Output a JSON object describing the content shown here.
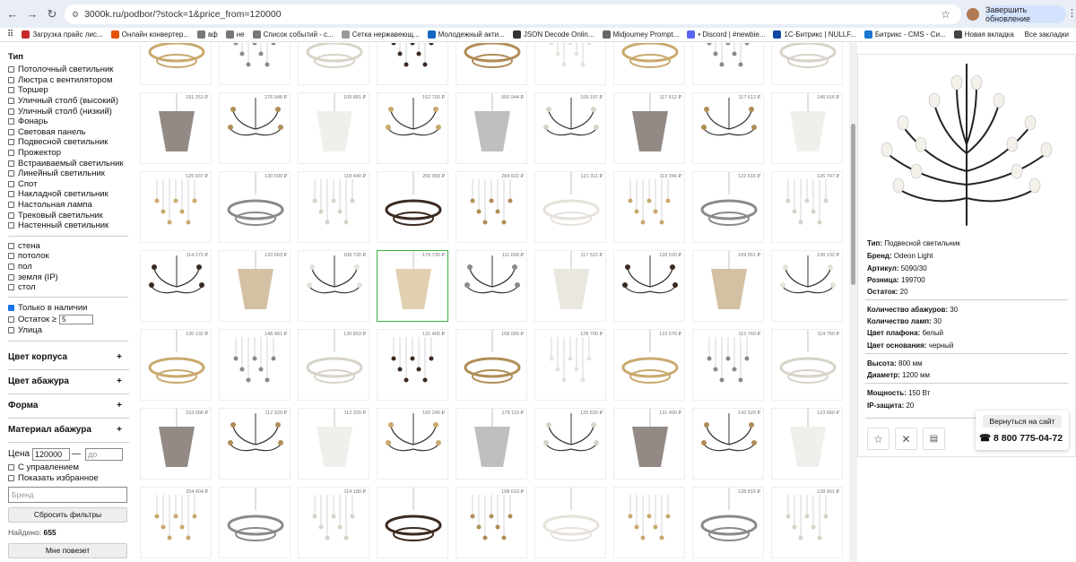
{
  "browser": {
    "url": "3000k.ru/podbor/?stock=1&price_from=120000",
    "update_label": "Завершить обновление",
    "bookmarks": [
      {
        "label": "Загрузка прайс лис...",
        "color": "#c62828"
      },
      {
        "label": "Онлайн конвертер...",
        "color": "#e65100"
      },
      {
        "label": "вф",
        "color": "#777"
      },
      {
        "label": "не",
        "color": "#777"
      },
      {
        "label": "Список событий - с...",
        "color": "#777"
      },
      {
        "label": "Сетка нержавеющ...",
        "color": "#999"
      },
      {
        "label": "Молодежный акти...",
        "color": "#1565c0"
      },
      {
        "label": "JSON Decode Onlin...",
        "color": "#333"
      },
      {
        "label": "Midjourney Prompt...",
        "color": "#666"
      },
      {
        "label": "• Discord | #newbie...",
        "color": "#5865f2"
      },
      {
        "label": "1С-Битрикс | NULLF...",
        "color": "#0d47a1"
      },
      {
        "label": "Битрикс - CMS - Си...",
        "color": "#1976d2"
      },
      {
        "label": "Новая вкладка",
        "color": "#444"
      }
    ],
    "all_bookmarks": "Все закладки"
  },
  "sidebar": {
    "type_heading": "Тип",
    "types": [
      "Потолочный светильник",
      "Люстра с вентилятором",
      "Торшер",
      "Уличный столб (высокий)",
      "Уличный столб (низкий)",
      "Фонарь",
      "Световая панель",
      "Подвесной светильник",
      "Прожектор",
      "Встраиваемый светильник",
      "Линейный светильник",
      "Спот",
      "Накладной светильник",
      "Настольная лампа",
      "Трековый светильник",
      "Настенный светильник"
    ],
    "mounts": [
      "стена",
      "потолок",
      "пол",
      "земля (IP)",
      "стол"
    ],
    "in_stock_label": "Только в наличии",
    "stock_label": "Остаток ≥",
    "stock_value": "5",
    "street_label": "Улица",
    "accordions": [
      "Цвет корпуса",
      "Цвет абажура",
      "Форма",
      "Материал абажура"
    ],
    "price_label": "Цена",
    "price_from": "120000",
    "price_to_placeholder": "до",
    "dimmer_label": "С управлением",
    "favorites_label": "Показать избранное",
    "brand_placeholder": "Бренд",
    "reset_label": "Сбросить фильтры",
    "found_label": "Найдено:",
    "found_count": "655",
    "lucky_label": "Мне повезет"
  },
  "grid": {
    "rows": [
      [
        "",
        "",
        "",
        "",
        "",
        "",
        "",
        "",
        ""
      ],
      [
        "181 253 ₽",
        "276 948 ₽",
        "109 881 ₽",
        "152 793 ₽",
        "560 944 ₽",
        "109 197 ₽",
        "117 612 ₽",
        "117 612 ₽",
        "146 916 ₽"
      ],
      [
        "125 937 ₽",
        "130 599 ₽",
        "118 440 ₽",
        "256 058 ₽",
        "284 922 ₽",
        "121 311 ₽",
        "113 346 ₽",
        "122 616 ₽",
        "126 747 ₽"
      ],
      [
        "114 273 ₽",
        "120 663 ₽",
        "108 720 ₽",
        "179 730 ₽",
        "111 608 ₽",
        "117 522 ₽",
        "128 520 ₽",
        "169 551 ₽",
        "138 132 ₽"
      ],
      [
        "130 132 ₽",
        "148 481 ₽",
        "130 803 ₽",
        "131 400 ₽",
        "108 000 ₽",
        "128 700 ₽",
        "123 570 ₽",
        "113 760 ₽",
        "114 750 ₽"
      ],
      [
        "153 000 ₽",
        "112 320 ₽",
        "112 320 ₽",
        "165 240 ₽",
        "178 110 ₽",
        "125 820 ₽",
        "131 400 ₽",
        "142 920 ₽",
        "123 660 ₽"
      ],
      [
        "334 404 ₽",
        "",
        "114 180 ₽",
        "",
        "108 619 ₽",
        "",
        "",
        "128 815 ₽",
        "128 901 ₽"
      ]
    ]
  },
  "detail": {
    "specs": [
      {
        "label": "Тип:",
        "value": "Подвесной светильник"
      },
      {
        "label": "Бренд:",
        "value": "Odeon Light"
      },
      {
        "label": "Артикул:",
        "value": "5090/30"
      },
      {
        "label": "Розница:",
        "value": "199700"
      },
      {
        "label": "Остаток:",
        "value": "20"
      },
      {
        "label": "Количество абажуров:",
        "value": "30"
      },
      {
        "label": "Количество ламп:",
        "value": "30"
      },
      {
        "label": "Цвет плафона:",
        "value": "белый"
      },
      {
        "label": "Цвет основания:",
        "value": "черный"
      },
      {
        "label": "Высота:",
        "value": "800 мм"
      },
      {
        "label": "Диаметр:",
        "value": "1200 мм"
      },
      {
        "label": "Мощность:",
        "value": "150 Вт"
      },
      {
        "label": "IP-защита:",
        "value": "20"
      }
    ],
    "back_label": "Вернуться на сайт",
    "phone": "☎ 8 800 775-04-72"
  }
}
